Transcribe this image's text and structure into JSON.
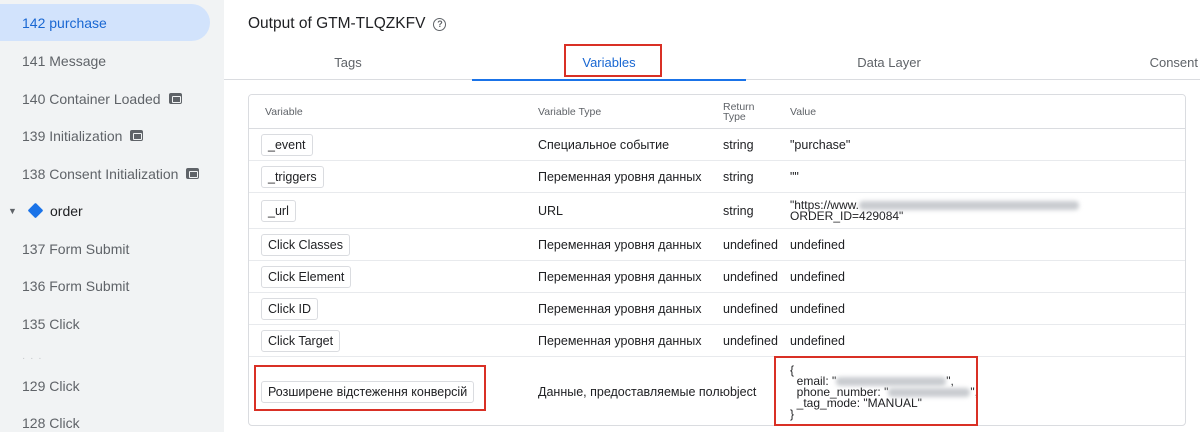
{
  "sidebar": {
    "items": [
      {
        "label": "142 purchase",
        "active": true
      },
      {
        "label": "141 Message"
      },
      {
        "label": "140 Container Loaded",
        "icon": "container-icon"
      },
      {
        "label": "139 Initialization",
        "icon": "container-icon"
      },
      {
        "label": "138 Consent Initialization",
        "icon": "container-icon"
      }
    ],
    "group": {
      "label": "order",
      "icon": "diamond-icon",
      "chevron": "chevron-down-icon"
    },
    "group_items": [
      {
        "label": "137 Form Submit"
      },
      {
        "label": "136 Form Submit"
      },
      {
        "label": "135 Click"
      },
      {
        "label": "129 Click"
      },
      {
        "label": "128 Click"
      }
    ]
  },
  "main": {
    "title": "Output of GTM-TLQZKFV",
    "help_icon": "help-circle-icon",
    "tabs": [
      {
        "label": "Tags"
      },
      {
        "label": "Variables",
        "active": true
      },
      {
        "label": "Data Layer"
      },
      {
        "label": "Consent"
      }
    ]
  },
  "table": {
    "headers": {
      "variable": "Variable",
      "type": "Variable Type",
      "return_line1": "Return",
      "return_line2": "Type",
      "value": "Value"
    },
    "rows": [
      {
        "variable": "_event",
        "type": "Специальное событие",
        "return": "string",
        "value": "\"purchase\""
      },
      {
        "variable": "_triggers",
        "type": "Переменная уровня данных",
        "return": "string",
        "value": "\"\""
      },
      {
        "variable": "_url",
        "type": "URL",
        "return": "string",
        "value_line1": "\"https://www.",
        "value_line2": "ORDER_ID=429084\""
      },
      {
        "variable": "Click Classes",
        "type": "Переменная уровня данных",
        "return": "undefined",
        "value": "undefined"
      },
      {
        "variable": "Click Element",
        "type": "Переменная уровня данных",
        "return": "undefined",
        "value": "undefined"
      },
      {
        "variable": "Click ID",
        "type": "Переменная уровня данных",
        "return": "undefined",
        "value": "undefined"
      },
      {
        "variable": "Click Target",
        "type": "Переменная уровня данных",
        "return": "undefined",
        "value": "undefined"
      },
      {
        "variable": "Розширене відстеження конверсій",
        "type": "Данные, предоставляемые поль",
        "return": "object",
        "obj_open": "{",
        "obj_email": "email: \"",
        "obj_phone": "phone_number: \"",
        "obj_tag": "_tag_mode: \"MANUAL\"",
        "obj_close": "}",
        "comma": "\","
      }
    ]
  },
  "colors": {
    "accent": "#1a73e8",
    "highlight": "#d93025",
    "sidebar_bg": "#f1f3f4",
    "active_bg": "#d2e3fc"
  }
}
